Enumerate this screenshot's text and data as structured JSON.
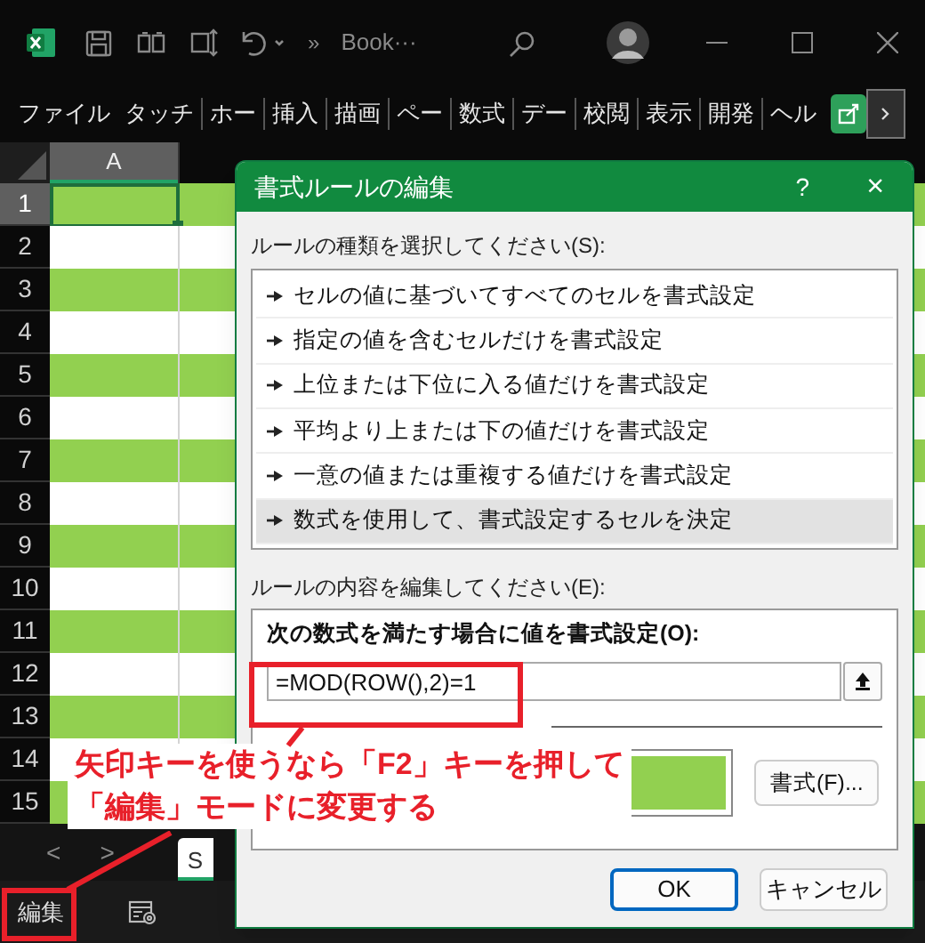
{
  "title_bar": {
    "title": "Book···",
    "overflow": "»"
  },
  "ribbon_tabs": [
    {
      "label": "ファイル"
    },
    {
      "label": "タッチ"
    },
    {
      "label": "ホー"
    },
    {
      "label": "挿入"
    },
    {
      "label": "描画"
    },
    {
      "label": "ペー"
    },
    {
      "label": "数式"
    },
    {
      "label": "デー"
    },
    {
      "label": "校閲"
    },
    {
      "label": "表示"
    },
    {
      "label": "開発"
    },
    {
      "label": "ヘル"
    }
  ],
  "grid": {
    "column_a": "A",
    "rows": [
      {
        "label": "1",
        "selected": true,
        "filled": true
      },
      {
        "label": "2",
        "selected": false,
        "filled": false
      },
      {
        "label": "3",
        "selected": false,
        "filled": true
      },
      {
        "label": "4",
        "selected": false,
        "filled": false
      },
      {
        "label": "5",
        "selected": false,
        "filled": true
      },
      {
        "label": "6",
        "selected": false,
        "filled": false
      },
      {
        "label": "7",
        "selected": false,
        "filled": true
      },
      {
        "label": "8",
        "selected": false,
        "filled": false
      },
      {
        "label": "9",
        "selected": false,
        "filled": true
      },
      {
        "label": "10",
        "selected": false,
        "filled": false
      },
      {
        "label": "11",
        "selected": false,
        "filled": true
      },
      {
        "label": "12",
        "selected": false,
        "filled": false
      },
      {
        "label": "13",
        "selected": false,
        "filled": true
      },
      {
        "label": "14",
        "selected": false,
        "filled": false
      },
      {
        "label": "15",
        "selected": false,
        "filled": true
      }
    ]
  },
  "sheet_bar": {
    "prev": "<",
    "next": ">",
    "sheet_tab": "S"
  },
  "status_bar": {
    "mode": "編集"
  },
  "dialog": {
    "title": "書式ルールの編集",
    "help": "?",
    "close": "×",
    "rule_type_label": "ルールの種類を選択してください(S):",
    "rule_types": [
      {
        "label": "セルの値に基づいてすべてのセルを書式設定",
        "selected": false
      },
      {
        "label": "指定の値を含むセルだけを書式設定",
        "selected": false
      },
      {
        "label": "上位または下位に入る値だけを書式設定",
        "selected": false
      },
      {
        "label": "平均より上または下の値だけを書式設定",
        "selected": false
      },
      {
        "label": "一意の値または重複する値だけを書式設定",
        "selected": false
      },
      {
        "label": "数式を使用して、書式設定するセルを決定",
        "selected": true
      }
    ],
    "rule_edit_label": "ルールの内容を編集してください(E):",
    "formula_label": "次の数式を満たす場合に値を書式設定(O):",
    "formula": "=MOD(ROW(),2)=1",
    "format_button": "書式(F)...",
    "buttons": [
      "OK",
      "キャンセル"
    ]
  },
  "callout": {
    "lines": [
      "矢印キーを使うなら「F2」キーを押して",
      "「編集」モードに変更する"
    ]
  }
}
